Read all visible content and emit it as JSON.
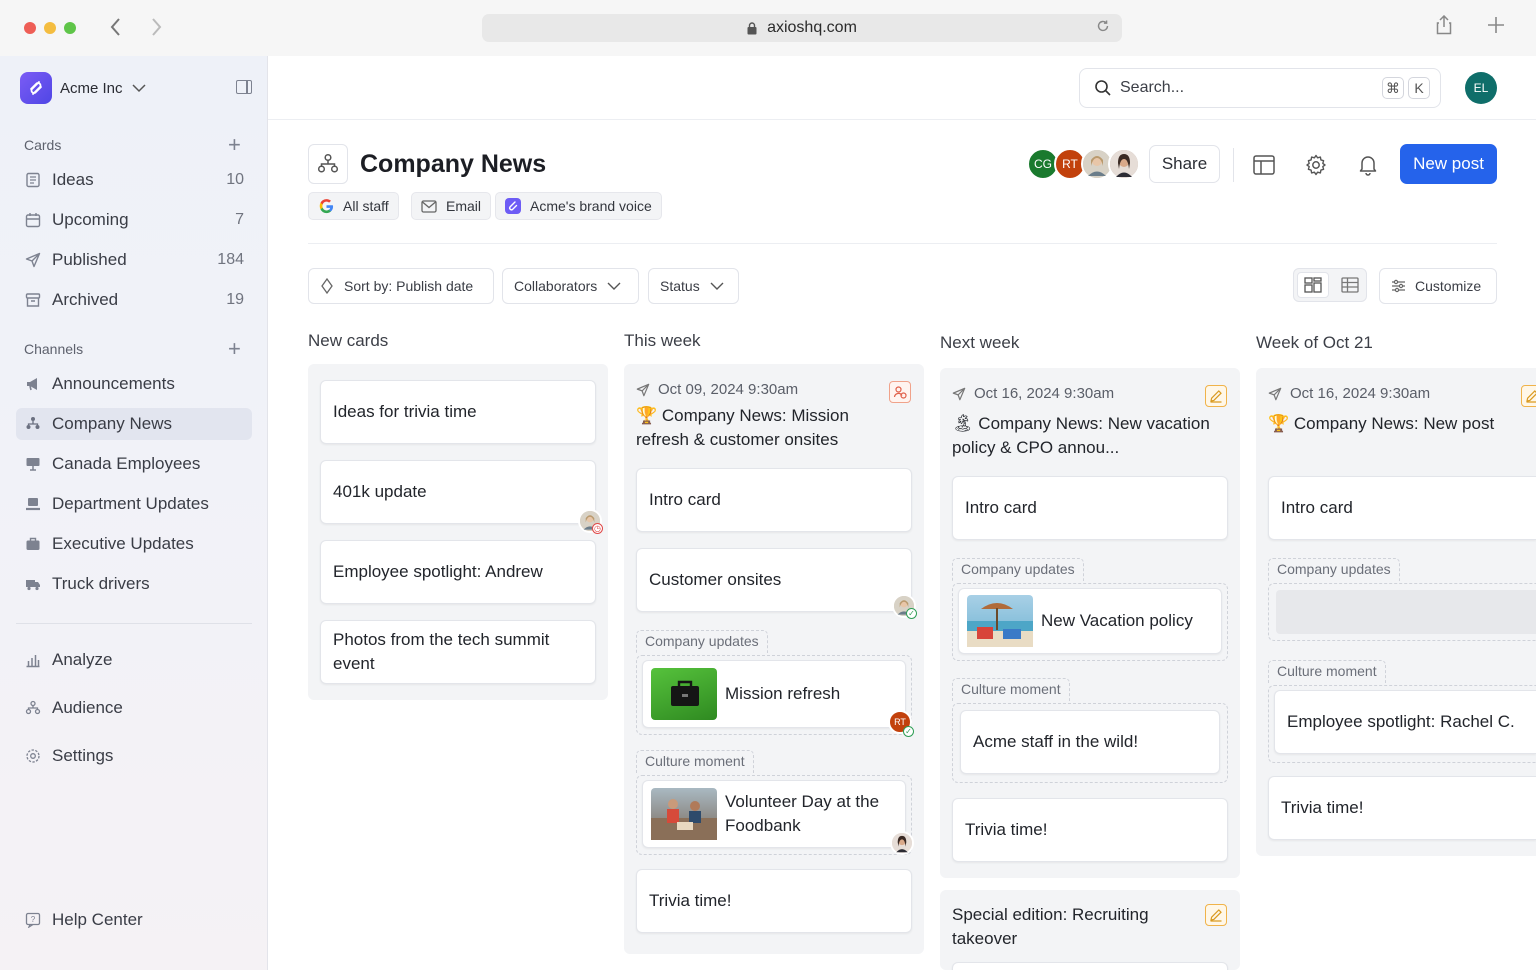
{
  "browser": {
    "url": "axioshq.com"
  },
  "sidebar": {
    "workspace": "Acme Inc",
    "cards_title": "Cards",
    "cards": [
      {
        "label": "Ideas",
        "count": "10"
      },
      {
        "label": "Upcoming",
        "count": "7"
      },
      {
        "label": "Published",
        "count": "184"
      },
      {
        "label": "Archived",
        "count": "19"
      }
    ],
    "channels_title": "Channels",
    "channels": [
      {
        "label": "Announcements"
      },
      {
        "label": "Company News"
      },
      {
        "label": "Canada Employees"
      },
      {
        "label": "Department Updates"
      },
      {
        "label": "Executive Updates"
      },
      {
        "label": "Truck drivers"
      }
    ],
    "bottom": [
      {
        "label": "Analyze"
      },
      {
        "label": "Audience"
      },
      {
        "label": "Settings"
      }
    ],
    "help": "Help Center"
  },
  "topbar": {
    "search_placeholder": "Search...",
    "kbd_cmd": "⌘",
    "kbd_k": "K",
    "user_initials": "EL"
  },
  "header": {
    "title": "Company News",
    "chips": [
      "All staff",
      "Email",
      "Acme's brand voice"
    ],
    "collaborators": [
      "CG",
      "RT"
    ],
    "share": "Share",
    "new_post": "New post"
  },
  "filters": {
    "sort": "Sort by: Publish date",
    "collaborators": "Collaborators",
    "status": "Status",
    "customize": "Customize"
  },
  "columns": {
    "new_cards": {
      "title": "New cards",
      "cards": [
        "Ideas for trivia time",
        "401k update",
        "Employee spotlight: Andrew",
        "Photos from the tech summit event"
      ]
    },
    "this_week": {
      "title": "This week",
      "date": "Oct 09, 2024 9:30am",
      "post_title": "🏆 Company News: Mission refresh & customer onsites",
      "intro": "Intro card",
      "onsites": "Customer onsites",
      "group1": "Company updates",
      "mission": "Mission refresh",
      "mission_avatar": "RT",
      "group2": "Culture moment",
      "volunteer": "Volunteer Day at the Foodbank",
      "trivia": "Trivia time!"
    },
    "next_week": {
      "title": "Next week",
      "date": "Oct 16, 2024 9:30am",
      "post_title": "🏝 Company News: New vacation policy & CPO annou...",
      "intro": "Intro card",
      "group1": "Company updates",
      "vacation": "New Vacation policy",
      "group2": "Culture moment",
      "staff": "Acme staff in the wild!",
      "trivia": "Trivia time!",
      "special": "Special edition: Recruiting takeover"
    },
    "oct21": {
      "title": "Week of Oct 21",
      "date": "Oct 16, 2024 9:30am",
      "post_title": "🏆 Company News: New post",
      "intro": "Intro card",
      "group1": "Company updates",
      "group2": "Culture moment",
      "spotlight": "Employee spotlight: Rachel C.",
      "trivia": "Trivia time!"
    }
  },
  "colors": {
    "primary": "#2563eb",
    "avatar_cg": "#1a7a2e",
    "avatar_rt": "#c2410c",
    "avatar_el": "#0f6e6a"
  }
}
